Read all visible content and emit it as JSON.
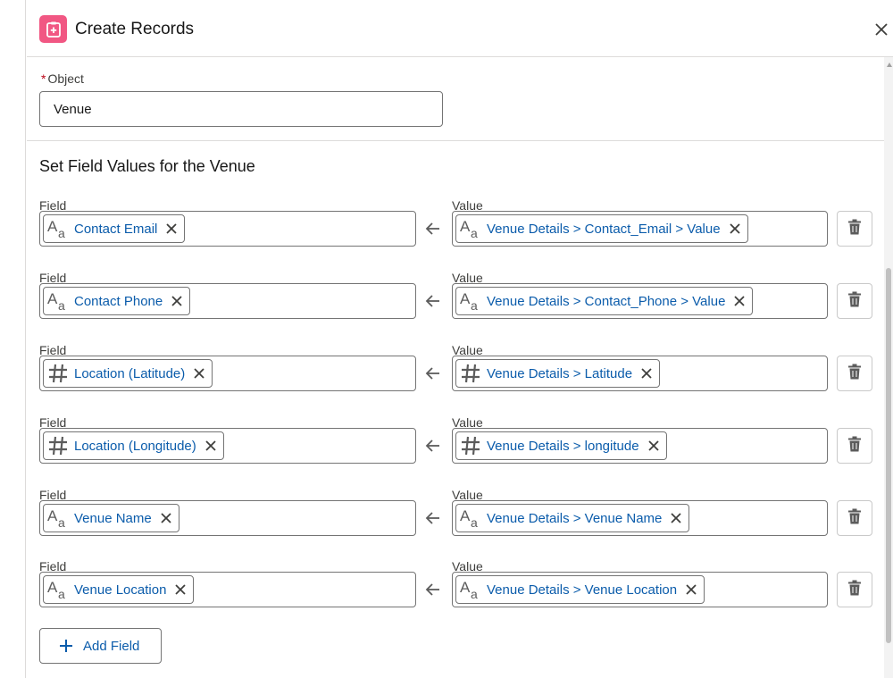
{
  "header": {
    "title": "Create Records",
    "icon": "create-records-icon",
    "icon_color": "#f15783",
    "close_icon": "close-icon"
  },
  "object": {
    "required_marker": "*",
    "label": "Object",
    "value": "Venue"
  },
  "section": {
    "title": "Set Field Values for the Venue"
  },
  "field_label": "Field",
  "value_label": "Value",
  "rows": [
    {
      "field_type": "text",
      "field": "Contact Email",
      "value_type": "text",
      "value": "Venue Details > Contact_Email > Value"
    },
    {
      "field_type": "text",
      "field": "Contact Phone",
      "value_type": "text",
      "value": "Venue Details > Contact_Phone > Value"
    },
    {
      "field_type": "number",
      "field": "Location (Latitude)",
      "value_type": "number",
      "value": "Venue Details > Latitude"
    },
    {
      "field_type": "number",
      "field": "Location (Longitude)",
      "value_type": "number",
      "value": "Venue Details > longitude"
    },
    {
      "field_type": "text",
      "field": "Venue Name",
      "value_type": "text",
      "value": "Venue Details > Venue Name"
    },
    {
      "field_type": "text",
      "field": "Venue Location",
      "value_type": "text",
      "value": "Venue Details > Venue Location"
    }
  ],
  "add_field_label": "Add Field",
  "colors": {
    "link": "#0b5cab",
    "required": "#ba0517",
    "border": "#747474"
  }
}
